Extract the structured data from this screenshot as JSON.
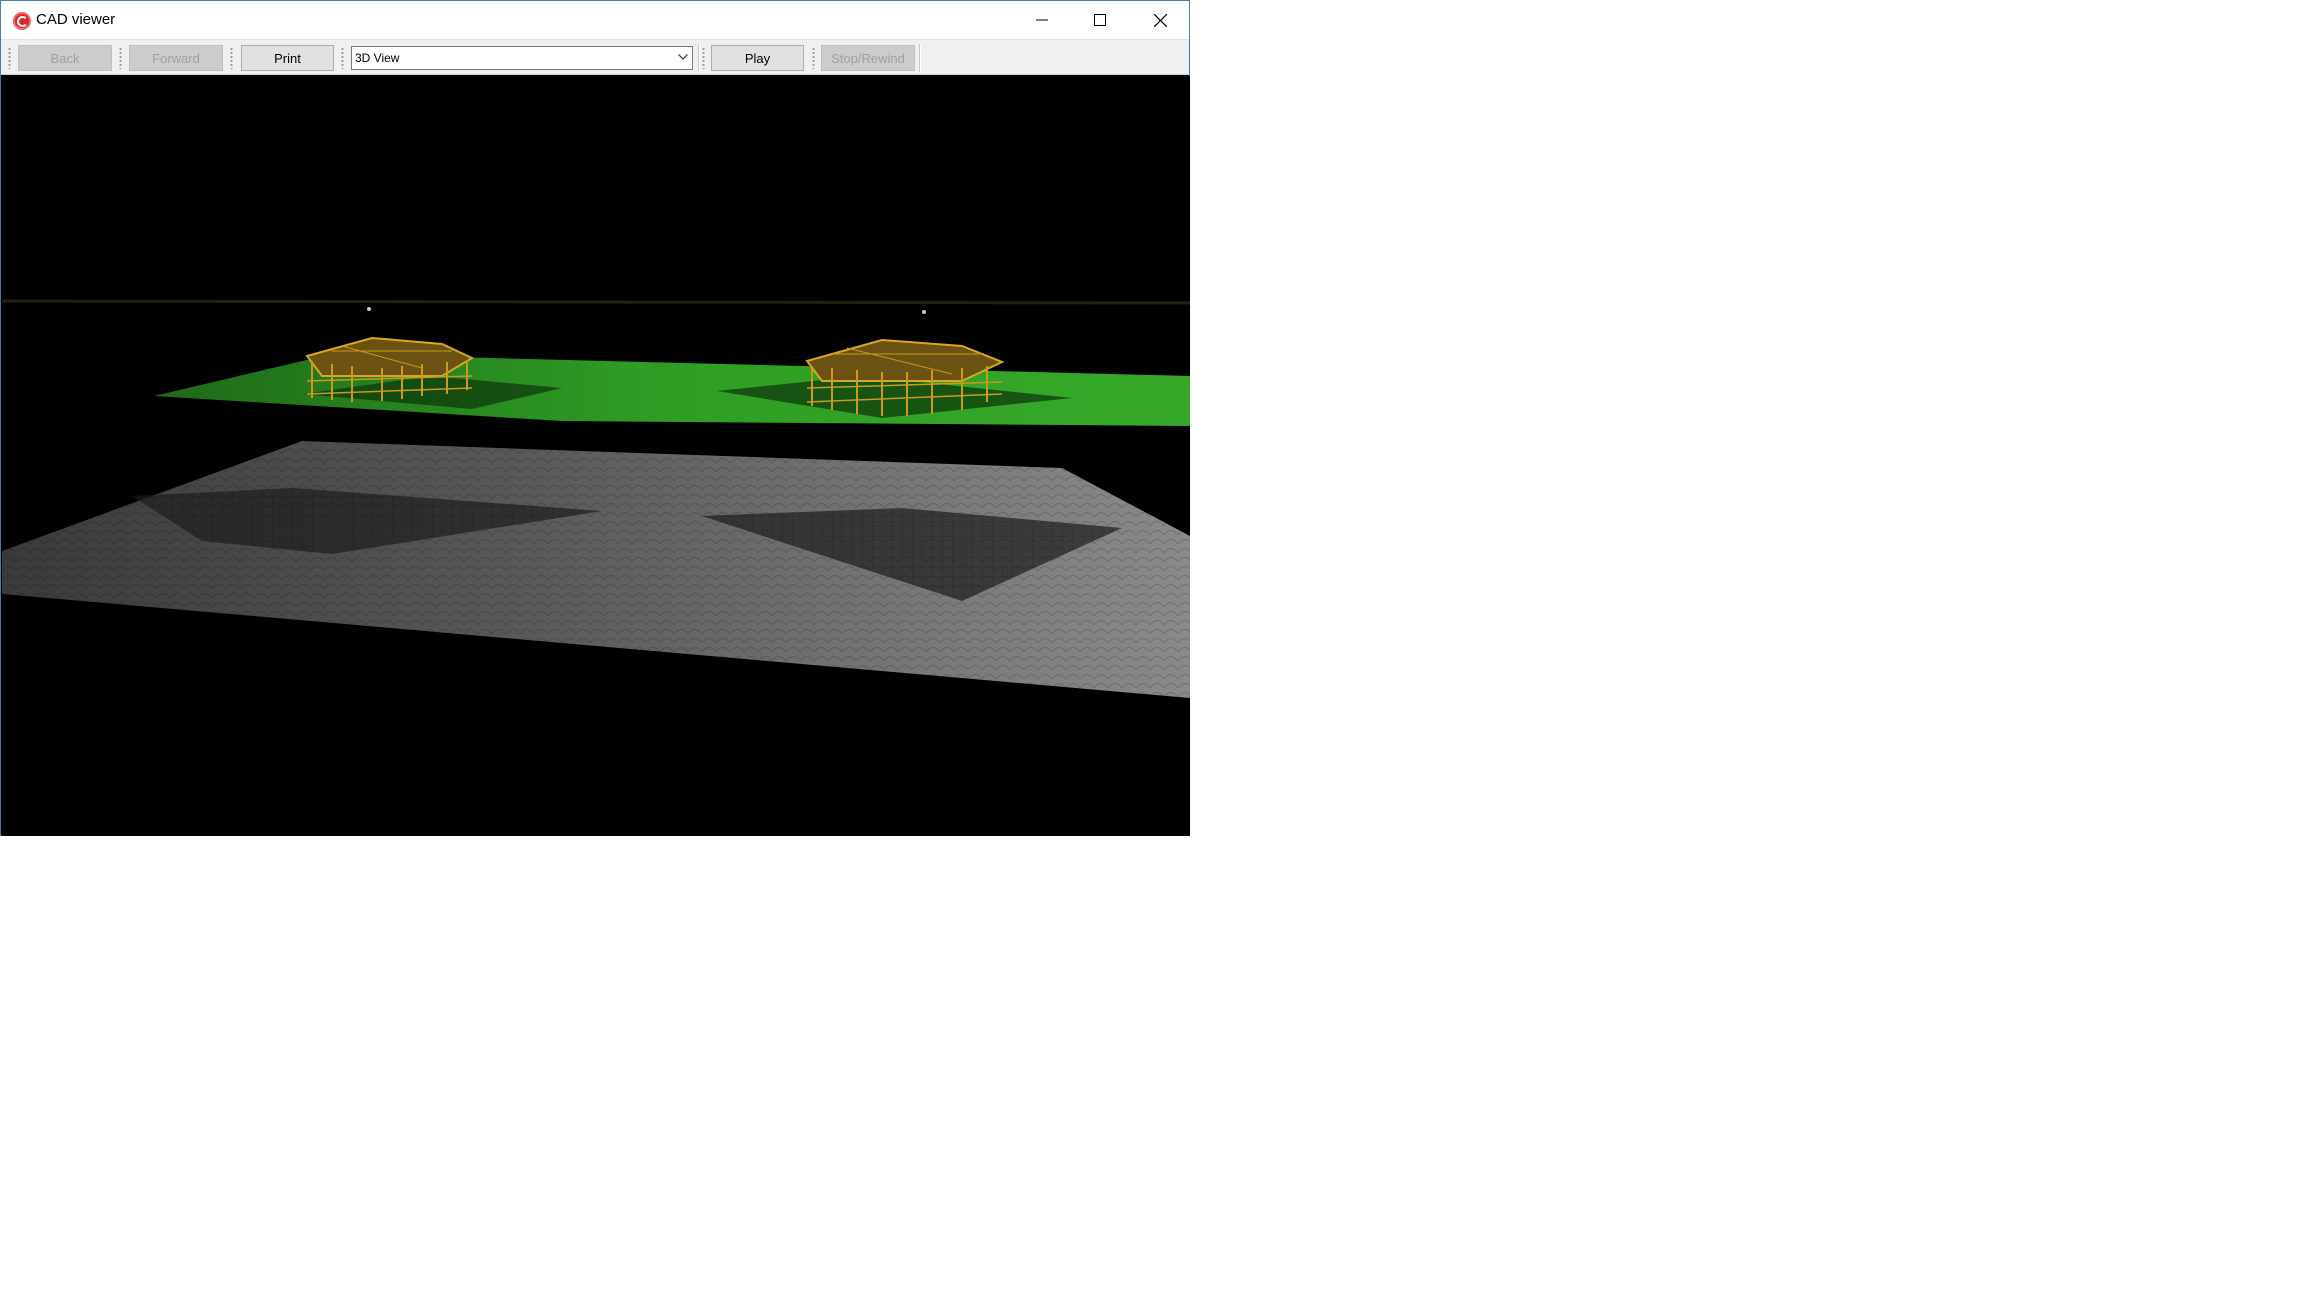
{
  "window": {
    "title": "CAD viewer",
    "app_icon": "cad-app-icon"
  },
  "caption_buttons": {
    "minimize_icon": "minimize-icon",
    "maximize_icon": "maximize-icon",
    "close_icon": "close-icon"
  },
  "toolbar": {
    "back_label": "Back",
    "forward_label": "Forward",
    "print_label": "Print",
    "view_selected": "3D View",
    "play_label": "Play",
    "stop_rewind_label": "Stop/Rewind"
  },
  "viewport": {
    "scene": "3D rendered scene: two wireframe building structures on a green plane above a grey textured ground plane with their shadows",
    "colors": {
      "background": "#000000",
      "green_plane": "#2f9e24",
      "structure": "#c89a1e",
      "ground": "#6a6a6a"
    }
  }
}
